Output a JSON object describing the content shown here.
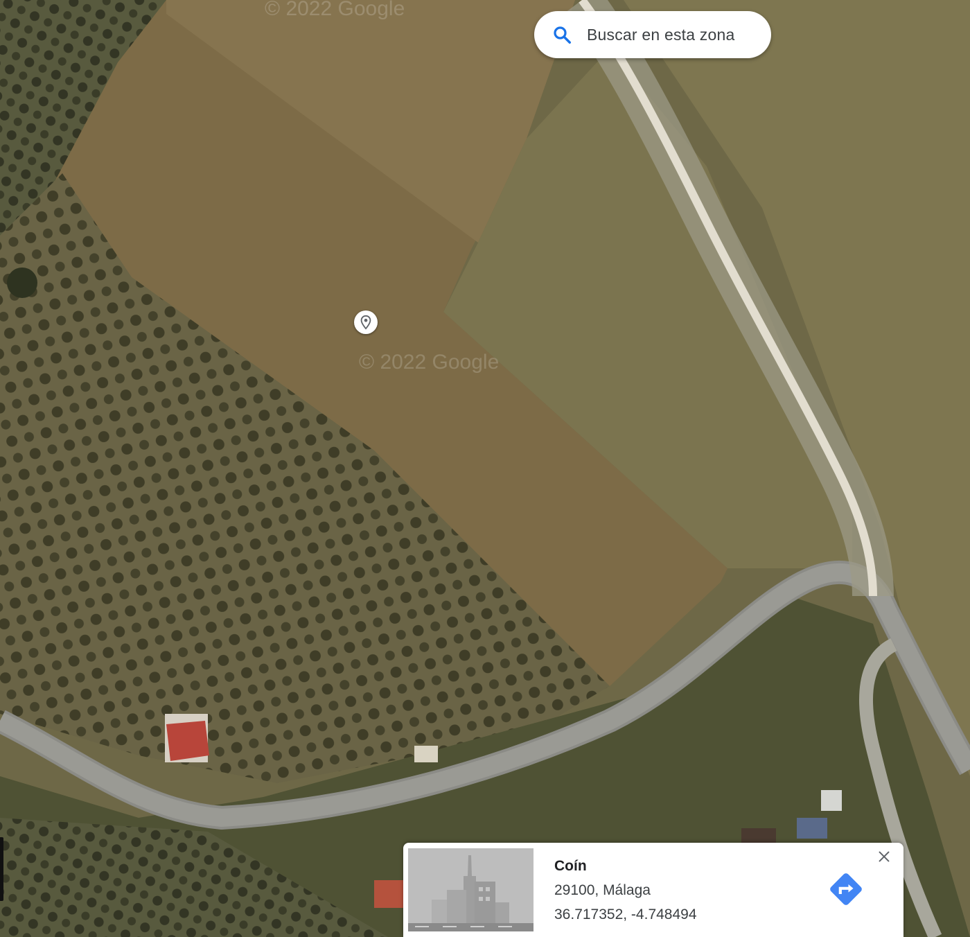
{
  "map": {
    "type": "satellite",
    "watermarks": [
      "© 2022 Google",
      "© 2022 Google"
    ],
    "colors": {
      "field": "#7a6a48",
      "field_light": "#8c7a55",
      "orchard": "#5f5a3c",
      "road": "#8a8a86",
      "dirt_track": "#d8d2c2"
    }
  },
  "search": {
    "label": "Buscar en esta zona",
    "icon": "search-icon",
    "icon_color": "#1a73e8"
  },
  "place_card": {
    "name": "Coín",
    "address": "29100, Málaga",
    "coordinates": "36.717352, -4.748494",
    "close_icon": "close-icon",
    "directions_icon": "directions-icon",
    "directions_color": "#4285f4"
  }
}
